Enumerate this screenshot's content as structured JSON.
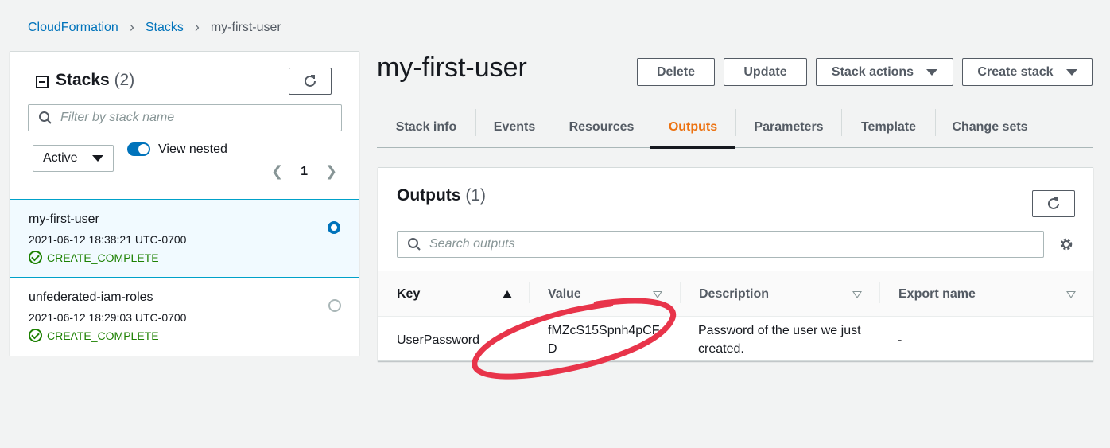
{
  "breadcrumb": {
    "items": [
      "CloudFormation",
      "Stacks",
      "my-first-user"
    ],
    "separator": ">"
  },
  "left_panel": {
    "title": "Stacks",
    "count": "(2)",
    "filter_placeholder": "Filter by stack name",
    "status_filter": "Active",
    "view_nested_label": "View nested",
    "view_nested_on": true,
    "page": "1",
    "stacks": [
      {
        "name": "my-first-user",
        "date": "2021-06-12 18:38:21 UTC-0700",
        "status": "CREATE_COMPLETE",
        "selected": true
      },
      {
        "name": "unfederated-iam-roles",
        "date": "2021-06-12 18:29:03 UTC-0700",
        "status": "CREATE_COMPLETE",
        "selected": false
      }
    ]
  },
  "main": {
    "title": "my-first-user",
    "buttons": {
      "delete": "Delete",
      "update": "Update",
      "stack_actions": "Stack actions",
      "create_stack": "Create stack"
    },
    "tabs": [
      "Stack info",
      "Events",
      "Resources",
      "Outputs",
      "Parameters",
      "Template",
      "Change sets"
    ],
    "active_tab": "Outputs"
  },
  "outputs": {
    "title": "Outputs",
    "count": "(1)",
    "search_placeholder": "Search outputs",
    "columns": [
      "Key",
      "Value",
      "Description",
      "Export name"
    ],
    "rows": [
      {
        "key": "UserPassword",
        "value_line1": "fMZcS15Spnh4pCF",
        "value_line2": "D",
        "description_line1": "Password of the user we just",
        "description_line2": "created.",
        "export_name": "-"
      }
    ]
  },
  "colors": {
    "link": "#0073bb",
    "accent": "#ec7211",
    "success": "#1d8102",
    "annotation": "#e8344a"
  }
}
